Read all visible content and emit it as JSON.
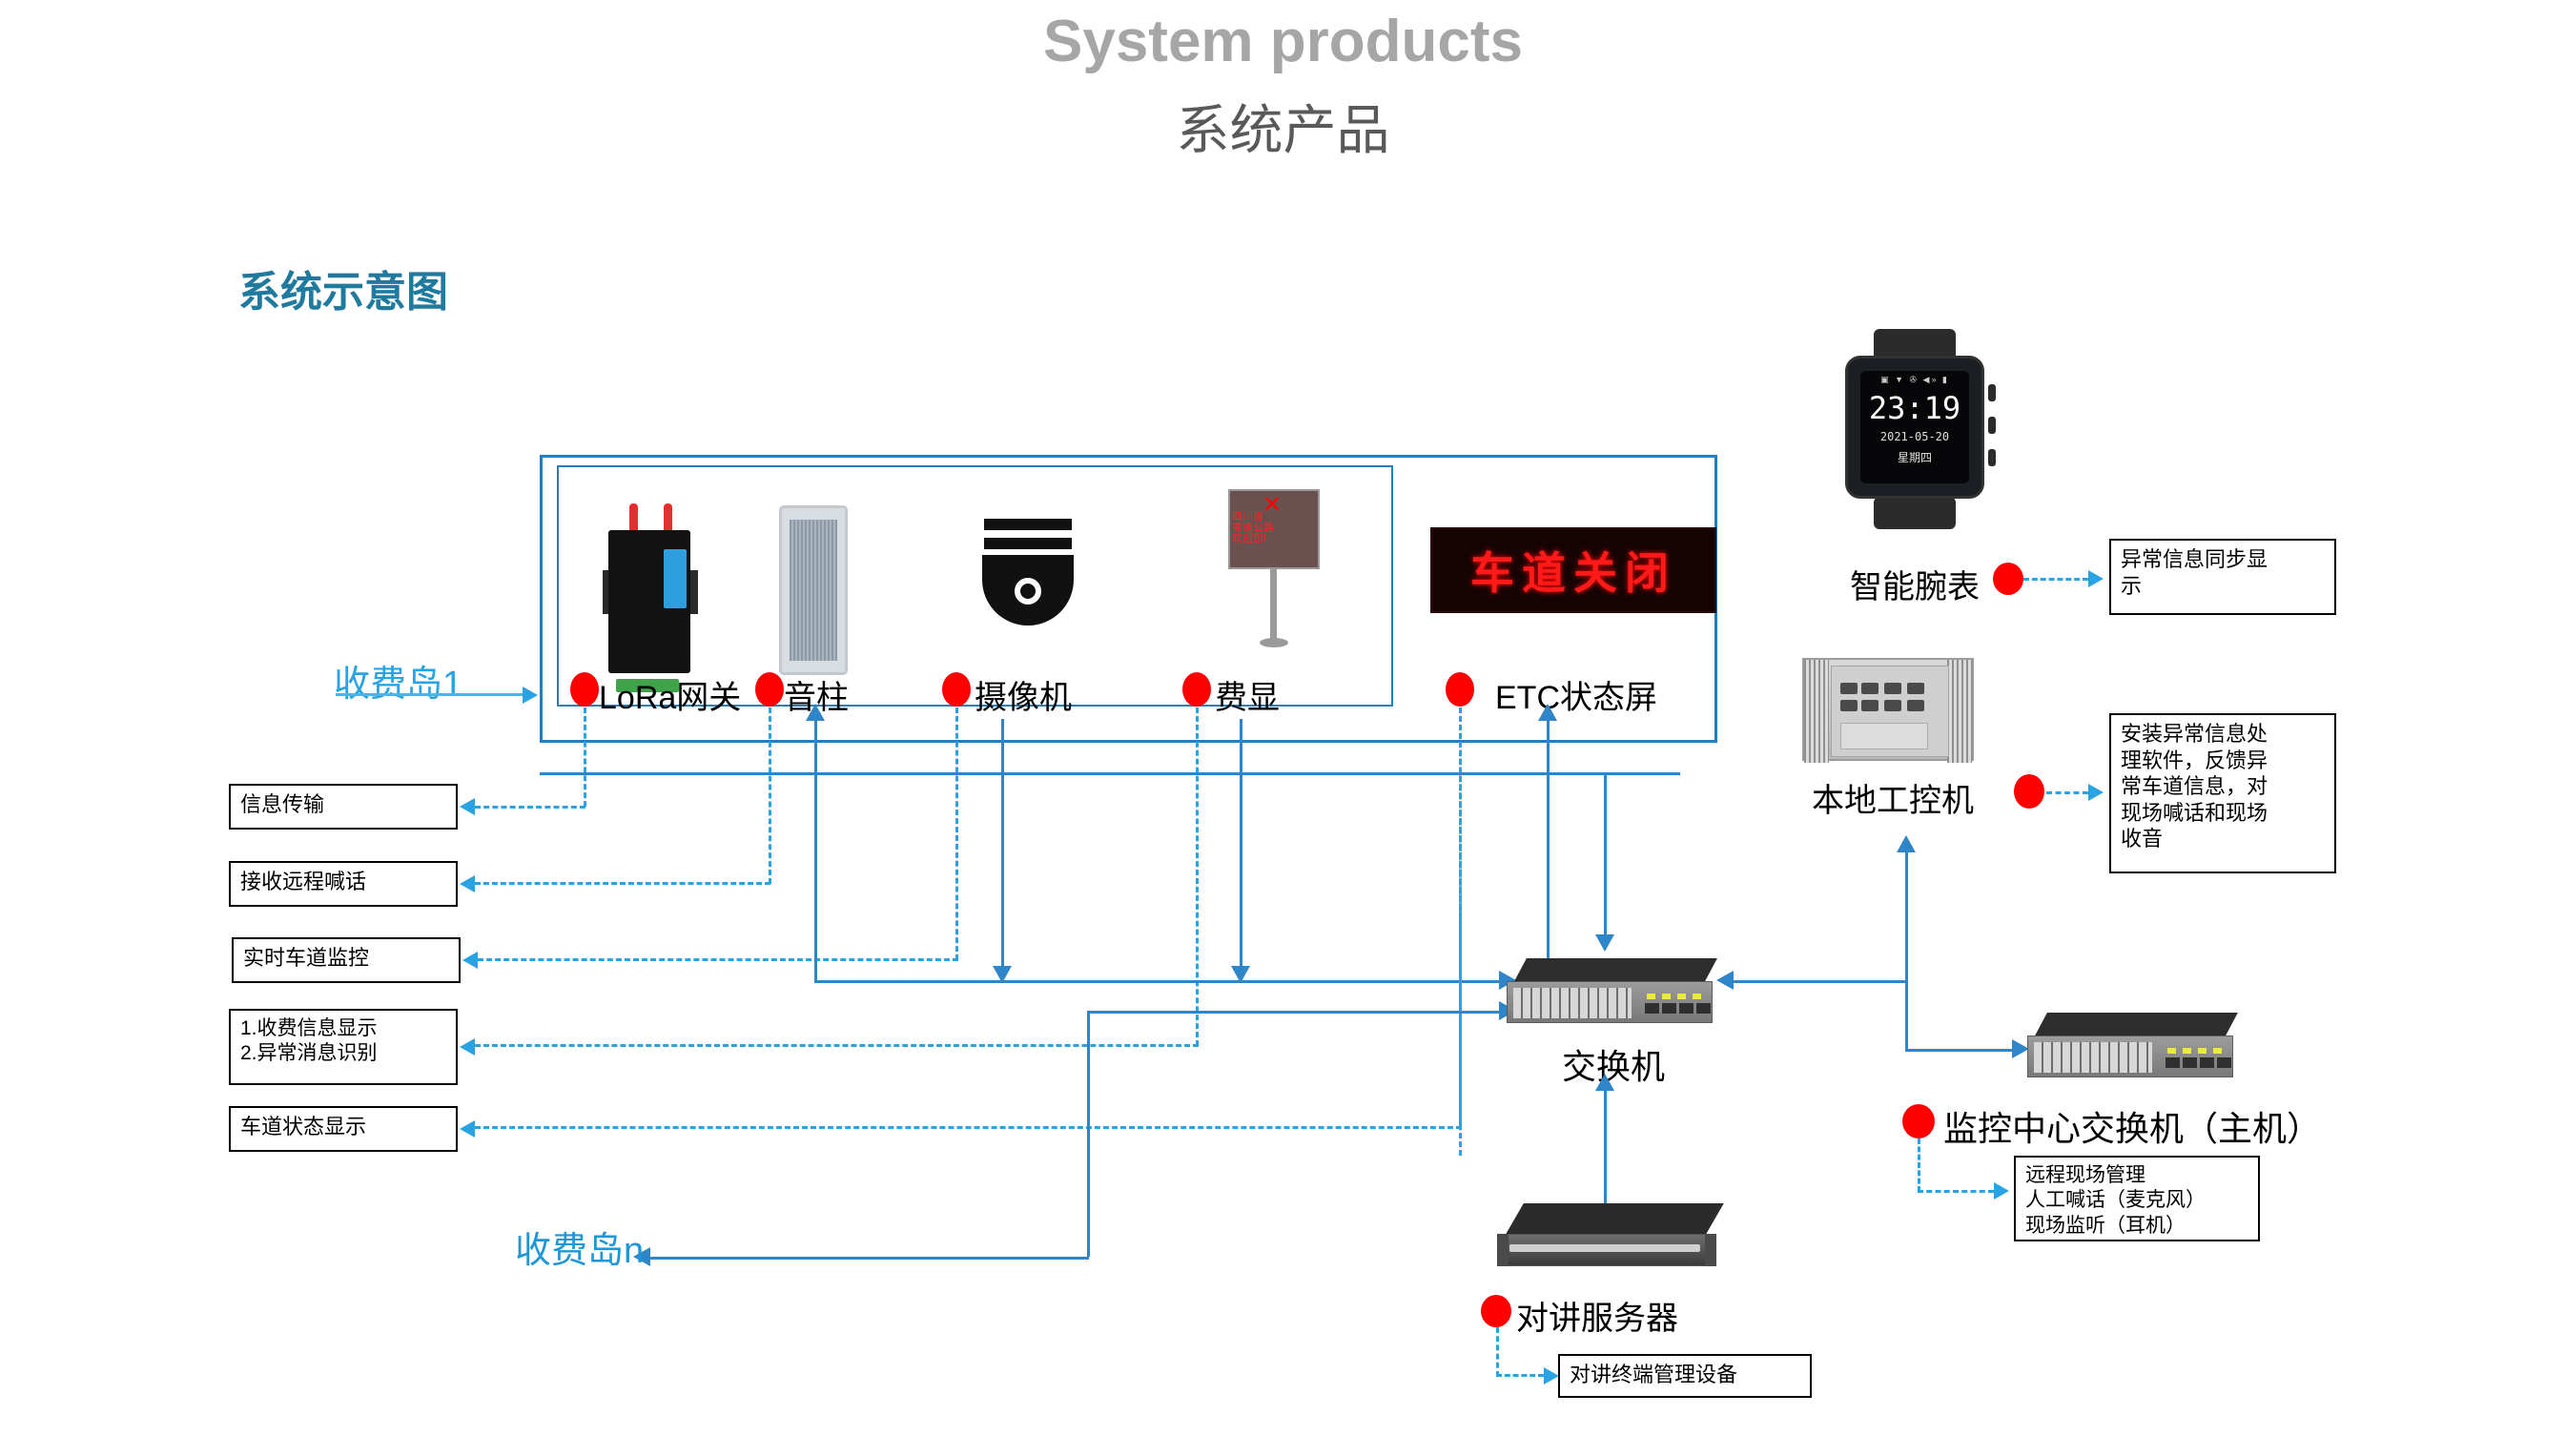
{
  "header": {
    "title_en": "System products",
    "title_cn": "系统产品",
    "section_title": "系统示意图"
  },
  "toll_island": {
    "first_label": "收费岛1",
    "last_label": "收费岛n"
  },
  "lane_devices": [
    {
      "id": "lora-gateway",
      "label": "LoRa网关",
      "icon": "lora-gateway-icon"
    },
    {
      "id": "sound-column",
      "label": "音柱",
      "icon": "speaker-column-icon"
    },
    {
      "id": "camera",
      "label": "摄像机",
      "icon": "dome-camera-icon"
    },
    {
      "id": "fee-display",
      "label": "费显",
      "icon": "fee-display-sign-icon"
    },
    {
      "id": "etc-status-screen",
      "label": "ETC状态屏",
      "icon": "led-panel-icon"
    }
  ],
  "fee_sign": {
    "cross": "✕",
    "line1": "四川省",
    "line2": "高速公路",
    "line3": "欢迎您!"
  },
  "etc_panel": {
    "text": "车道关闭"
  },
  "left_notes": [
    {
      "id": "note-info-transmission",
      "lines": [
        "信息传输"
      ]
    },
    {
      "id": "note-receive-remote-call",
      "lines": [
        "接收远程喊话"
      ]
    },
    {
      "id": "note-realtime-lane-monitor",
      "lines": [
        "实时车道监控"
      ]
    },
    {
      "id": "note-fee-and-abnormal",
      "lines": [
        "1.收费信息显示",
        "2.异常消息识别"
      ]
    },
    {
      "id": "note-lane-status-display",
      "lines": [
        "车道状态显示"
      ]
    }
  ],
  "right_column": {
    "watch": {
      "label": "智能腕表",
      "icons": "▣ ▼ ✇ ◀» ▮",
      "time": "23:19",
      "date": "2021-05-20",
      "weekday": "星期四"
    },
    "watch_note": {
      "lines": [
        "异常信息同步显",
        "示"
      ]
    },
    "industrial_pc": {
      "label": "本地工控机"
    },
    "industrial_pc_note": {
      "lines": [
        "安装异常信息处",
        "理软件，反馈异",
        "常车道信息，对",
        "现场喊话和现场",
        "收音"
      ]
    },
    "center_switch": {
      "label": "监控中心交换机（主机）"
    },
    "center_switch_note": {
      "lines": [
        "远程现场管理",
        "人工喊话（麦克风）",
        "现场监听（耳机）"
      ]
    }
  },
  "center_column": {
    "switch": {
      "label": "交换机"
    },
    "intercom_server": {
      "label": "对讲服务器"
    },
    "intercom_server_note": {
      "lines": [
        "对讲终端管理设备"
      ]
    }
  },
  "colors": {
    "accent_blue": "#1f7fc0",
    "light_blue": "#29a3e3",
    "line_blue": "#2e86c8",
    "dot_red": "#ff0000",
    "title_gray": "#a6a6a6",
    "subtitle_gray": "#595959",
    "section_teal": "#1f7a9e"
  }
}
